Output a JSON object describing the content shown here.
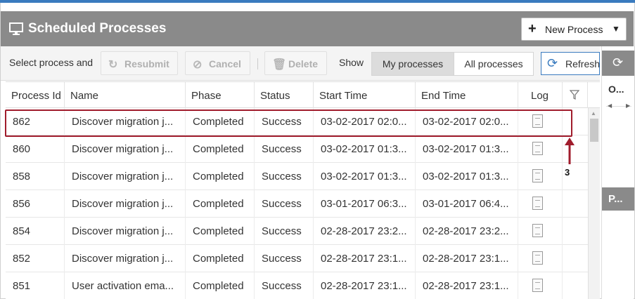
{
  "header": {
    "title": "Scheduled Processes",
    "new_process_label": "New Process"
  },
  "toolbar": {
    "select_text": "Select process and",
    "resubmit_label": "Resubmit",
    "cancel_label": "Cancel",
    "delete_label": "Delete",
    "show_label": "Show",
    "my_processes_label": "My processes",
    "all_processes_label": "All processes",
    "refresh_label": "Refresh"
  },
  "table": {
    "columns": [
      "Process Id",
      "Name",
      "Phase",
      "Status",
      "Start Time",
      "End Time",
      "Log"
    ],
    "rows": [
      {
        "id": "862",
        "name": "Discover migration j...",
        "phase": "Completed",
        "status": "Success",
        "start": "03-02-2017 02:0...",
        "end": "03-02-2017 02:0..."
      },
      {
        "id": "860",
        "name": "Discover migration j...",
        "phase": "Completed",
        "status": "Success",
        "start": "03-02-2017 01:3...",
        "end": "03-02-2017 01:3..."
      },
      {
        "id": "858",
        "name": "Discover migration j...",
        "phase": "Completed",
        "status": "Success",
        "start": "03-02-2017 01:3...",
        "end": "03-02-2017 01:3..."
      },
      {
        "id": "856",
        "name": "Discover migration j...",
        "phase": "Completed",
        "status": "Success",
        "start": "03-01-2017 06:3...",
        "end": "03-01-2017 06:4..."
      },
      {
        "id": "854",
        "name": "Discover migration j...",
        "phase": "Completed",
        "status": "Success",
        "start": "02-28-2017 23:2...",
        "end": "02-28-2017 23:2..."
      },
      {
        "id": "852",
        "name": "Discover migration j...",
        "phase": "Completed",
        "status": "Success",
        "start": "02-28-2017 23:1...",
        "end": "02-28-2017 23:1..."
      },
      {
        "id": "851",
        "name": "User activation ema...",
        "phase": "Completed",
        "status": "Success",
        "start": "02-28-2017 23:1...",
        "end": "02-28-2017 23:1..."
      }
    ]
  },
  "annotation": {
    "number": "3"
  },
  "right_panel": {
    "column_label": "O...",
    "button_label": "P..."
  },
  "colors": {
    "header_bg": "#8a8a8a",
    "accent": "#3a7bbf",
    "highlight": "#a01c2c"
  }
}
